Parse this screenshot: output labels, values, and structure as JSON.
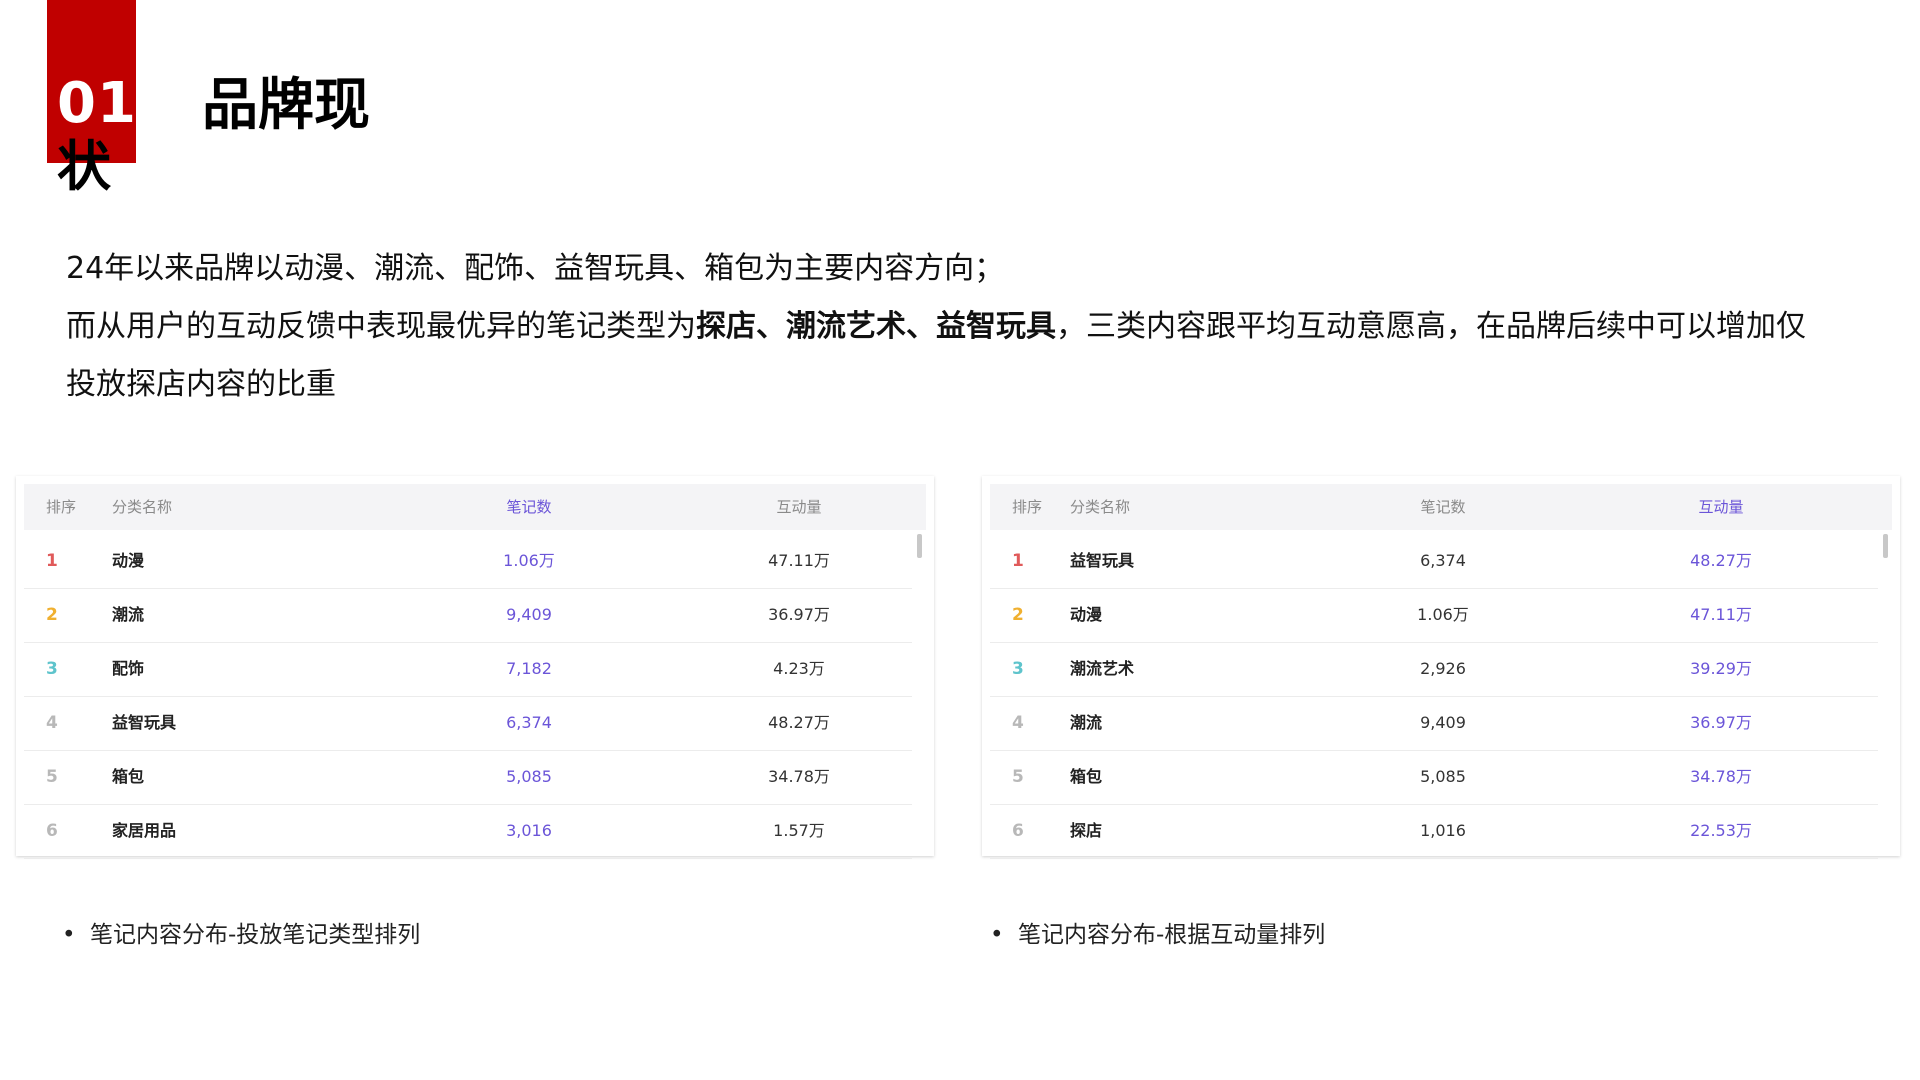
{
  "header": {
    "section_number": "01",
    "section_title": "品牌现",
    "section_title_wrap": "状"
  },
  "summary": {
    "line1": "24年以来品牌以动漫、潮流、配饰、益智玩具、箱包为主要内容方向；",
    "line2_prefix": "而从用户的互动反馈中表现最优异的笔记类型为",
    "line2_bold": "探店、潮流艺术、益智玩具",
    "line2_suffix": "，三类内容跟平均互动意愿高，在品牌后续中可以增加仅投放探店内容的比重"
  },
  "colors": {
    "accent_red": "#c00000",
    "accent_purple": "#6b55d8",
    "rank1": "#e05a5a",
    "rank2": "#f0b030",
    "rank3": "#5ec4cc",
    "rank_other": "#b8b8b8"
  },
  "tables": [
    {
      "columns": [
        "排序",
        "分类名称",
        "笔记数",
        "互动量"
      ],
      "active_column": "笔记数",
      "caption": "笔记内容分布-投放笔记类型排列",
      "rows": [
        {
          "rank": "1",
          "name": "动漫",
          "notes": "1.06万",
          "interactions": "47.11万"
        },
        {
          "rank": "2",
          "name": "潮流",
          "notes": "9,409",
          "interactions": "36.97万"
        },
        {
          "rank": "3",
          "name": "配饰",
          "notes": "7,182",
          "interactions": "4.23万"
        },
        {
          "rank": "4",
          "name": "益智玩具",
          "notes": "6,374",
          "interactions": "48.27万"
        },
        {
          "rank": "5",
          "name": "箱包",
          "notes": "5,085",
          "interactions": "34.78万"
        },
        {
          "rank": "6",
          "name": "家居用品",
          "notes": "3,016",
          "interactions": "1.57万"
        }
      ]
    },
    {
      "columns": [
        "排序",
        "分类名称",
        "笔记数",
        "互动量"
      ],
      "active_column": "互动量",
      "caption": "笔记内容分布-根据互动量排列",
      "rows": [
        {
          "rank": "1",
          "name": "益智玩具",
          "notes": "6,374",
          "interactions": "48.27万"
        },
        {
          "rank": "2",
          "name": "动漫",
          "notes": "1.06万",
          "interactions": "47.11万"
        },
        {
          "rank": "3",
          "name": "潮流艺术",
          "notes": "2,926",
          "interactions": "39.29万"
        },
        {
          "rank": "4",
          "name": "潮流",
          "notes": "9,409",
          "interactions": "36.97万"
        },
        {
          "rank": "5",
          "name": "箱包",
          "notes": "5,085",
          "interactions": "34.78万"
        },
        {
          "rank": "6",
          "name": "探店",
          "notes": "1,016",
          "interactions": "22.53万"
        }
      ]
    }
  ]
}
